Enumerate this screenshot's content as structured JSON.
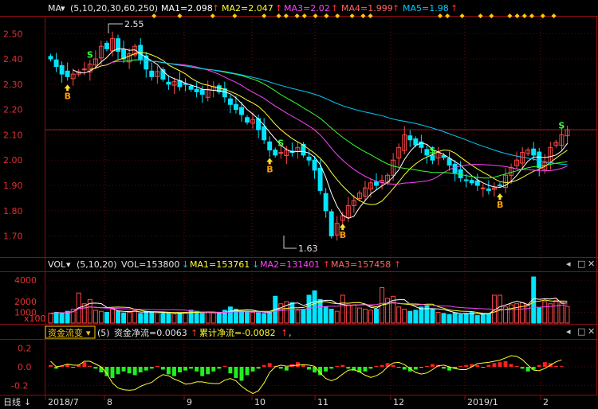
{
  "colors": {
    "up": "#ff4a4a",
    "down": "#00e5ff",
    "grid": "#7a0b0b",
    "ma1": "#ffffff",
    "ma2": "#ffff33",
    "ma3": "#ff44ff",
    "ma4": "#33ff33",
    "ma5": "#00ccff",
    "text_white": "#e6e6e6",
    "accent_red": "#ff3030",
    "buy_b": "#ff9a00",
    "sell_s": "#33ff33",
    "diamond": "#ffcc00"
  },
  "main_panel": {
    "indicator_name": "MA",
    "params": "(5,10,20,30,60,250)",
    "ma_values": [
      {
        "label": "MA1=2.098",
        "arrow": "↑"
      },
      {
        "label": "MA2=2.047",
        "arrow": "↑"
      },
      {
        "label": "MA3=2.02",
        "arrow": "↑"
      },
      {
        "label": "MA4=1.999",
        "arrow": "↑"
      },
      {
        "label": "MA5=1.98",
        "arrow": "↑"
      }
    ],
    "high_label": "2.55",
    "low_label": "1.63"
  },
  "vol_panel": {
    "indicator_name": "VOL",
    "params": "(5,10,20)",
    "values": [
      {
        "label": "VOL=153800",
        "arrow": "↓"
      },
      {
        "label": "MA1=153761",
        "arrow": "↓"
      },
      {
        "label": "MA2=131401",
        "arrow": "↑"
      },
      {
        "label": "MA3=157458",
        "arrow": "↑"
      }
    ],
    "unit_label": "x100",
    "y_ticks": [
      "4000",
      "2000",
      "1000"
    ]
  },
  "flow_panel": {
    "indicator_name": "资金流变",
    "params": "(5)",
    "values": [
      {
        "label": "资金净流=0.0063",
        "arrow": "↑"
      },
      {
        "label": "累计净流=-0.0082",
        "arrow": "↑"
      }
    ],
    "trailing": ",",
    "y_ticks": [
      "0.2",
      "0.0",
      "-0.2"
    ]
  },
  "bottom_bar": {
    "period_label": "日线",
    "x_labels": [
      "2018/7",
      "8",
      "9",
      "10",
      "11",
      "12",
      "2019/1",
      "2"
    ]
  },
  "chart_data": [
    {
      "type": "candlestick",
      "title": "",
      "ylim": [
        1.62,
        2.57
      ],
      "y_ticks": [
        2.5,
        2.4,
        2.3,
        2.2,
        2.1,
        2.0,
        1.9,
        1.8,
        1.7
      ],
      "grid": true,
      "high": 2.55,
      "low": 1.63,
      "last_close": 2.12,
      "x_labels": [
        "2018/7",
        "8",
        "9",
        "10",
        "11",
        "12",
        "2019/1",
        "2"
      ],
      "close_series": [
        2.4,
        2.37,
        2.34,
        2.33,
        2.34,
        2.35,
        2.36,
        2.38,
        2.4,
        2.45,
        2.44,
        2.48,
        2.43,
        2.4,
        2.42,
        2.45,
        2.4,
        2.36,
        2.33,
        2.35,
        2.32,
        2.3,
        2.31,
        2.29,
        2.3,
        2.28,
        2.27,
        2.26,
        2.28,
        2.29,
        2.27,
        2.25,
        2.22,
        2.2,
        2.18,
        2.15,
        2.16,
        2.12,
        2.08,
        2.04,
        2.02,
        2.03,
        2.04,
        2.03,
        2.05,
        2.02,
        2.0,
        1.96,
        1.88,
        1.8,
        1.7,
        1.75,
        1.78,
        1.82,
        1.84,
        1.87,
        1.89,
        1.91,
        1.9,
        1.92,
        1.94,
        2.0,
        2.05,
        2.1,
        2.08,
        2.06,
        2.05,
        2.02,
        2.0,
        2.03,
        2.01,
        1.98,
        1.95,
        1.93,
        1.92,
        1.91,
        1.9,
        1.89,
        1.88,
        1.89,
        1.9,
        1.94,
        1.97,
        2.0,
        2.03,
        2.04,
        2.02,
        1.97,
        1.99,
        2.05,
        2.07,
        2.1,
        2.12
      ],
      "series": [
        {
          "name": "MA1",
          "value": 2.098
        },
        {
          "name": "MA2",
          "value": 2.047
        },
        {
          "name": "MA3",
          "value": 2.02
        },
        {
          "name": "MA4",
          "value": 1.999
        },
        {
          "name": "MA5",
          "value": 1.98
        }
      ],
      "signals": [
        {
          "type": "B",
          "x_index": 3
        },
        {
          "type": "S",
          "x_index": 7
        },
        {
          "type": "B",
          "x_index": 39
        },
        {
          "type": "S",
          "x_index": 41
        },
        {
          "type": "B",
          "x_index": 52
        },
        {
          "type": "S",
          "x_index": 68
        },
        {
          "type": "B",
          "x_index": 80
        },
        {
          "type": "S",
          "x_index": 91
        },
        {
          "type": "B",
          "x_index": 93
        }
      ]
    },
    {
      "type": "bar",
      "title": "VOL",
      "ylim": [
        0,
        4600
      ],
      "unit": "x100",
      "values": [
        900,
        1000,
        950,
        1100,
        1300,
        2800,
        1800,
        2200,
        1200,
        1100,
        1000,
        1300,
        1100,
        950,
        1000,
        1200,
        900,
        1100,
        1000,
        950,
        900,
        1000,
        850,
        900,
        1000,
        1200,
        1100,
        900,
        1000,
        950,
        900,
        1200,
        1500,
        1300,
        1100,
        1100,
        1000,
        950,
        900,
        1000,
        2500,
        1800,
        2000,
        1900,
        1200,
        1300,
        2600,
        3000,
        2200,
        1500,
        1300,
        1100,
        2600,
        1700,
        1700,
        1400,
        1300,
        1200,
        1300,
        3300,
        2300,
        2500,
        1500,
        1300,
        1100,
        1200,
        1500,
        1600,
        1300,
        1000,
        900,
        800,
        950,
        800,
        900,
        1000,
        700,
        800,
        900,
        2600,
        2600,
        1500,
        1700,
        1800,
        1900,
        1700,
        4300,
        1400,
        2000,
        1800,
        2100,
        1900,
        1538
      ],
      "series": [
        {
          "name": "VOL",
          "value": 153800
        },
        {
          "name": "MA1",
          "value": 153761
        },
        {
          "name": "MA2",
          "value": 131401
        },
        {
          "name": "MA3",
          "value": 157458
        }
      ]
    },
    {
      "type": "bar",
      "title": "资金流变",
      "ylim": [
        -0.3,
        0.3
      ],
      "values": [
        0.02,
        -0.02,
        0.01,
        0.03,
        -0.01,
        0.02,
        0.05,
        0.01,
        -0.02,
        -0.06,
        -0.1,
        -0.12,
        -0.08,
        -0.05,
        -0.07,
        -0.09,
        -0.06,
        -0.04,
        -0.02,
        0.01,
        -0.03,
        -0.08,
        -0.1,
        -0.06,
        -0.04,
        -0.02,
        -0.05,
        -0.1,
        -0.08,
        -0.05,
        -0.02,
        0.01,
        -0.07,
        -0.12,
        -0.15,
        -0.09,
        -0.05,
        -0.02,
        0.02,
        0.04,
        0.01,
        -0.02,
        -0.04,
        0.03,
        0.05,
        0.02,
        -0.03,
        -0.06,
        -0.09,
        -0.05,
        -0.02,
        0.01,
        0.02,
        -0.02,
        -0.04,
        -0.06,
        -0.05,
        -0.02,
        0.01,
        0.02,
        0.04,
        0.02,
        -0.01,
        -0.03,
        -0.05,
        -0.03,
        -0.01,
        0.01,
        0.03,
        0.02,
        -0.02,
        -0.04,
        -0.02,
        0.01,
        0.02,
        0.03,
        0.02,
        -0.01,
        0.02,
        0.04,
        0.05,
        0.06,
        0.03,
        0.01,
        -0.02,
        -0.05,
        -0.03,
        0.02,
        0.05,
        0.04,
        0.01,
        0.0063
      ],
      "series": [
        {
          "name": "资金净流",
          "value": 0.0063
        },
        {
          "name": "累计净流",
          "value": -0.0082
        }
      ]
    }
  ]
}
